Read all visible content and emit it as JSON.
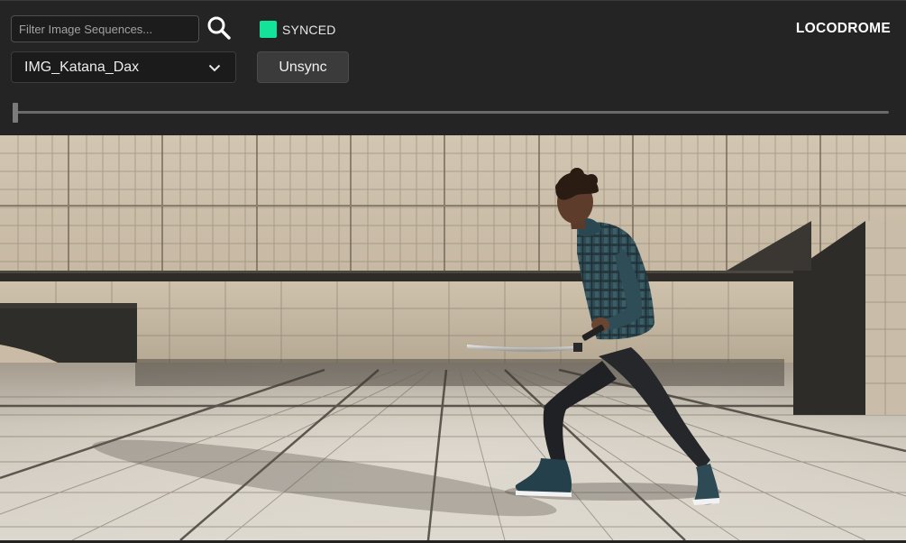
{
  "toolbar": {
    "filter_placeholder": "Filter Image Sequences...",
    "filter_value": "",
    "search_icon": "search-icon",
    "sync_status_label": "SYNCED",
    "sync_status_color": "#14e39a",
    "brand": "LOCODROME",
    "sequence_selected": "IMG_Katana_Dax",
    "sequence_chevron_icon": "chevron-down-icon",
    "unsync_label": "Unsync"
  },
  "timeline": {
    "position": 0
  },
  "viewport": {
    "content": "render-frame"
  },
  "colors": {
    "toolbar_bg": "#242424",
    "accent": "#14e39a"
  }
}
